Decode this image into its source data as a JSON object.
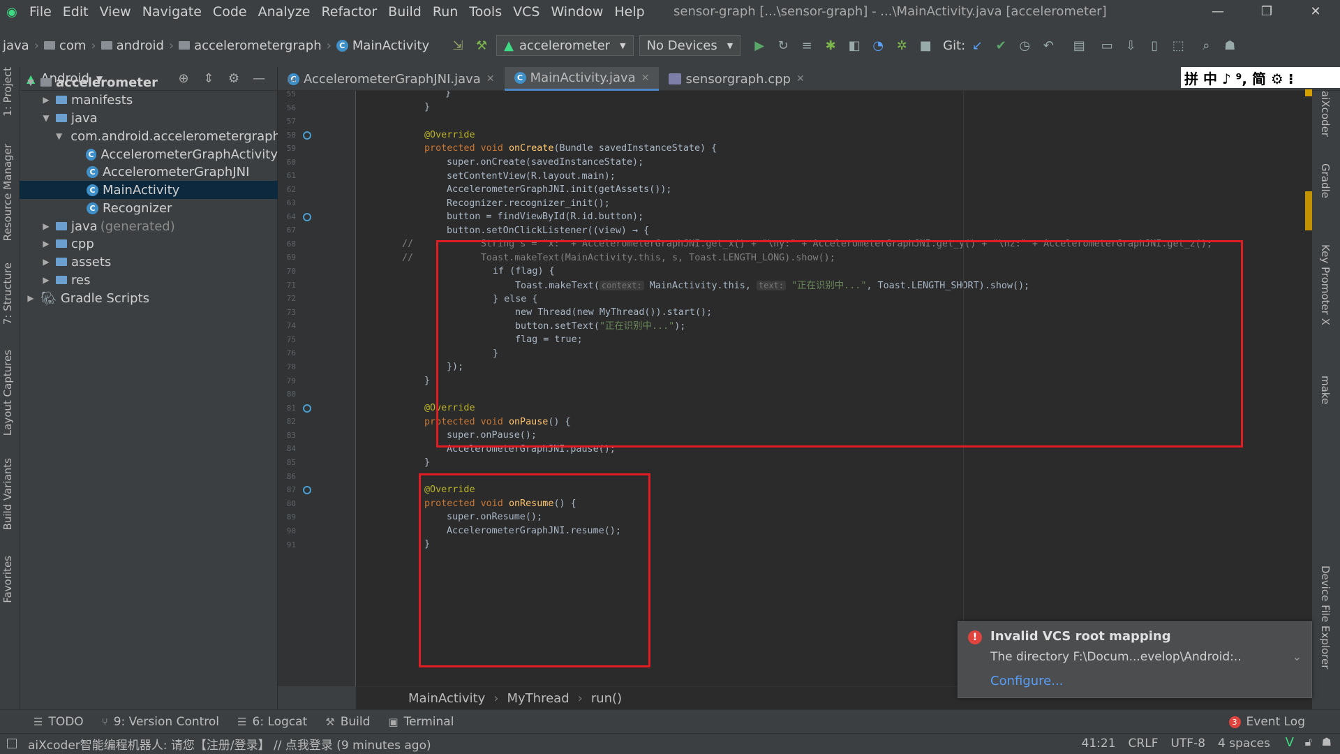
{
  "menu": [
    "File",
    "Edit",
    "View",
    "Navigate",
    "Code",
    "Analyze",
    "Refactor",
    "Build",
    "Run",
    "Tools",
    "VCS",
    "Window",
    "Help"
  ],
  "window_title": "sensor-graph [...\\sensor-graph] - ...\\MainActivity.java [accelerometer]",
  "breadcrumb": [
    "java",
    "com",
    "android",
    "accelerometergraph",
    "MainActivity"
  ],
  "run_config": "accelerometer",
  "device": "No Devices",
  "git_label": "Git:",
  "project_panel": {
    "view": "Android",
    "tree": [
      {
        "label": "accelerometer",
        "depth": 0,
        "type": "module",
        "arrow": "open",
        "bold": true
      },
      {
        "label": "manifests",
        "depth": 1,
        "type": "folder",
        "arrow": "closed"
      },
      {
        "label": "java",
        "depth": 1,
        "type": "folder",
        "arrow": "open"
      },
      {
        "label": "com.android.accelerometergraph",
        "depth": 2,
        "type": "package",
        "arrow": "open"
      },
      {
        "label": "AccelerometerGraphActivity",
        "depth": 3,
        "type": "class"
      },
      {
        "label": "AccelerometerGraphJNI",
        "depth": 3,
        "type": "class"
      },
      {
        "label": "MainActivity",
        "depth": 3,
        "type": "class",
        "selected": true
      },
      {
        "label": "Recognizer",
        "depth": 3,
        "type": "class"
      },
      {
        "label": "java",
        "suffix": "(generated)",
        "depth": 1,
        "type": "folder",
        "arrow": "closed"
      },
      {
        "label": "cpp",
        "depth": 1,
        "type": "folder",
        "arrow": "closed"
      },
      {
        "label": "assets",
        "depth": 1,
        "type": "folder",
        "arrow": "closed"
      },
      {
        "label": "res",
        "depth": 1,
        "type": "folder",
        "arrow": "closed"
      },
      {
        "label": "Gradle Scripts",
        "depth": 0,
        "type": "gradle",
        "arrow": "closed"
      }
    ]
  },
  "left_tabs": [
    "1: Project",
    "Resource Manager",
    "7: Structure",
    "Layout Captures",
    "Build Variants",
    "Favorites"
  ],
  "right_tabs": [
    "aiXcoder",
    "Gradle",
    "Key Promoter X",
    "make",
    "Device File Explorer"
  ],
  "editor_tabs": [
    {
      "label": "AccelerometerGraphJNI.java",
      "active": false
    },
    {
      "label": "MainActivity.java",
      "active": true
    },
    {
      "label": "sensorgraph.cpp",
      "active": false
    }
  ],
  "ime_bar": "拼 中 ♪ ⁹, 简 ⚙ ⁝",
  "line_numbers": [
    "54",
    "55",
    "56",
    "57",
    "58",
    "59",
    "60",
    "61",
    "62",
    "63",
    "64",
    "67",
    "68",
    "69",
    "70",
    "71",
    "72",
    "73",
    "74",
    "75",
    "76",
    "78",
    "79",
    "80",
    "81",
    "82",
    "83",
    "84",
    "85",
    "86",
    "87",
    "88",
    "89",
    "90",
    "91"
  ],
  "code_breadcrumb": [
    "MainActivity",
    "MyThread",
    "run()"
  ],
  "notification": {
    "title": "Invalid VCS root mapping",
    "body": "The directory F:\\Docum...evelop\\Android:..",
    "action": "Configure..."
  },
  "bottom_tools": [
    "TODO",
    "9: Version Control",
    "6: Logcat",
    "Build",
    "Terminal"
  ],
  "event_log": {
    "count": "3",
    "label": "Event Log"
  },
  "status": {
    "message": "aiXcoder智能编程机器人: 请您【注册/登录】 // 点我登录 (9 minutes ago)",
    "position": "41:21",
    "line_sep": "CRLF",
    "encoding": "UTF-8",
    "indent": "4 spaces"
  },
  "code": {
    "l54": "}",
    "l55": "}",
    "l57": "@Override",
    "l58_kw": "protected void ",
    "l58_fn": "onCreate",
    "l58_rest": "(Bundle savedInstanceState) {",
    "l59": "super.onCreate(savedInstanceState);",
    "l60": "setContentView(R.layout.main);",
    "l61": "AccelerometerGraphJNI.init(getAssets());",
    "l62": "Recognizer.recognizer_init();",
    "l63": "button = findViewById(R.id.button);",
    "l64": "button.setOnClickListener((view) → {",
    "l67": "//            String s = \"x:\" + AccelerometerGraphJNI.get_x() + \"\\ny:\" + AccelerometerGraphJNI.get_y() + \"\\nz:\" + AccelerometerGraphJNI.get_z();",
    "l68": "//            Toast.makeText(MainActivity.this, s, Toast.LENGTH_LONG).show();",
    "l69": "if (flag) {",
    "l70_a": "Toast.makeText(",
    "l70_h1": "context:",
    "l70_b": " MainActivity.this, ",
    "l70_h2": "text:",
    "l70_s": " \"正在识别中...\"",
    "l70_c": ", Toast.LENGTH_SHORT).show();",
    "l71": "} else {",
    "l72": "new Thread(new MyThread()).start();",
    "l73_a": "button.setText(",
    "l73_s": "\"正在识别中...\"",
    "l73_b": ");",
    "l74": "flag = true;",
    "l75": "}",
    "l76": "});",
    "l78": "}",
    "l80": "@Override",
    "l81_kw": "protected void ",
    "l81_fn": "onPause",
    "l81_rest": "() {",
    "l82": "super.onPause();",
    "l83": "AccelerometerGraphJNI.pause();",
    "l84": "}",
    "l86": "@Override",
    "l87_kw": "protected void ",
    "l87_fn": "onResume",
    "l87_rest": "() {",
    "l88": "super.onResume();",
    "l89": "AccelerometerGraphJNI.resume();",
    "l90": "}"
  },
  "colors": {
    "accent": "#4a88c7",
    "highlight_box": "#e11c23",
    "selection": "#0d293e"
  }
}
